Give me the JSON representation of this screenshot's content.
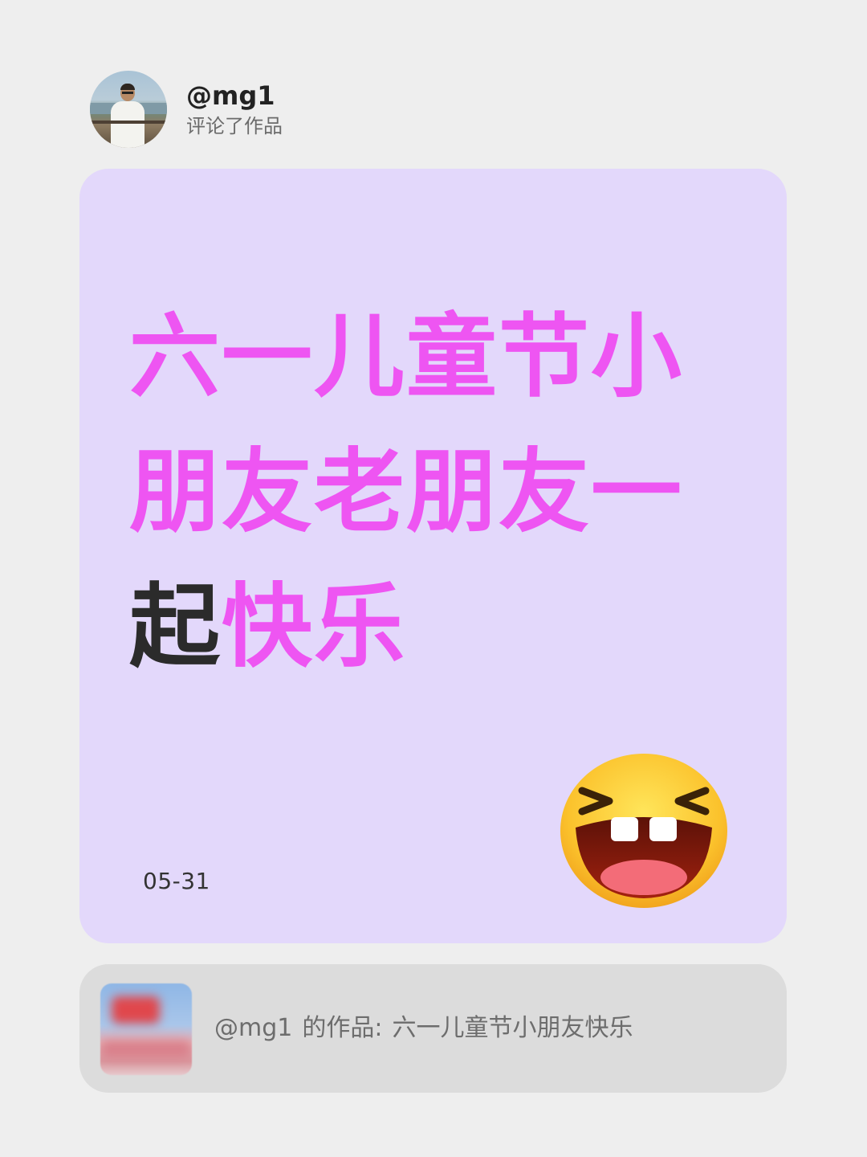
{
  "header": {
    "username": "@mg1",
    "action": "评论了作品"
  },
  "card": {
    "headline_part1": "六一儿童节小朋友老朋友一",
    "headline_part2": "起",
    "headline_part3": "快乐",
    "date": "05-31",
    "background_color": "#e3d8fb",
    "accent_color": "#ee55f2",
    "emoji_icon": "laughing-face-emoji"
  },
  "reference": {
    "author": "@mg1",
    "label": "的作品:",
    "title": "六一儿童节小朋友快乐"
  }
}
